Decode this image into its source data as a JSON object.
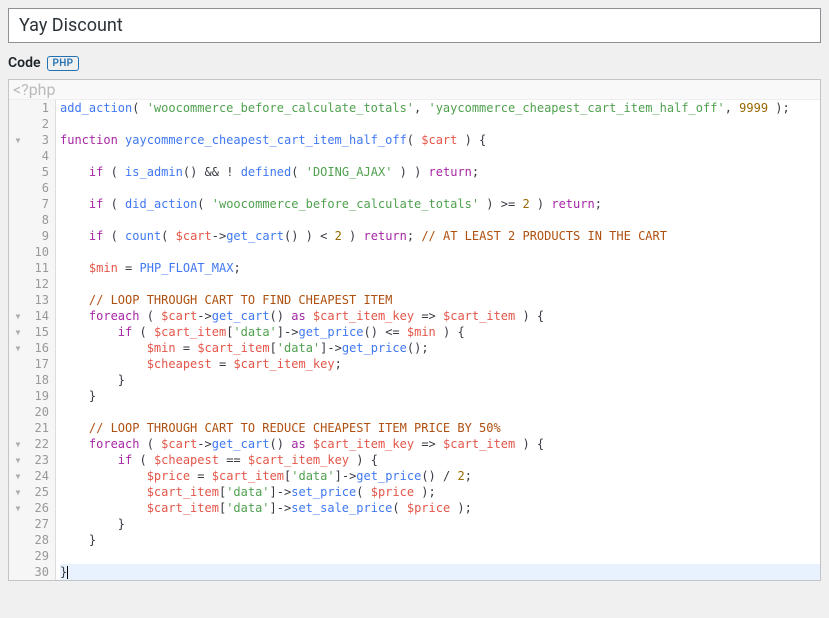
{
  "title_value": "Yay Discount",
  "section": {
    "label": "Code",
    "badge": "PHP"
  },
  "ghost_line": "<?php",
  "lines": [
    {
      "n": 1,
      "fold": "",
      "tokens": [
        [
          "fn",
          "add_action"
        ],
        [
          "pun",
          "( "
        ],
        [
          "str",
          "'woocommerce_before_calculate_totals'"
        ],
        [
          "pun",
          ", "
        ],
        [
          "str",
          "'yaycommerce_cheapest_cart_item_half_off'"
        ],
        [
          "pun",
          ", "
        ],
        [
          "num",
          "9999"
        ],
        [
          "pun",
          " );"
        ]
      ]
    },
    {
      "n": 2,
      "fold": "",
      "tokens": []
    },
    {
      "n": 3,
      "fold": "▾",
      "tokens": [
        [
          "kw",
          "function"
        ],
        [
          "op",
          " "
        ],
        [
          "fn",
          "yaycommerce_cheapest_cart_item_half_off"
        ],
        [
          "pun",
          "( "
        ],
        [
          "var",
          "$cart"
        ],
        [
          "pun",
          " ) {"
        ]
      ]
    },
    {
      "n": 4,
      "fold": "",
      "tokens": []
    },
    {
      "n": 5,
      "fold": "",
      "indent": 1,
      "tokens": [
        [
          "ctrl",
          "if"
        ],
        [
          "pun",
          " ( "
        ],
        [
          "fn",
          "is_admin"
        ],
        [
          "pun",
          "() "
        ],
        [
          "op",
          "&&"
        ],
        [
          "pun",
          " "
        ],
        [
          "op",
          "!"
        ],
        [
          "pun",
          " "
        ],
        [
          "fn",
          "defined"
        ],
        [
          "pun",
          "( "
        ],
        [
          "str",
          "'DOING_AJAX'"
        ],
        [
          "pun",
          " ) ) "
        ],
        [
          "ctrl",
          "return"
        ],
        [
          "pun",
          ";"
        ]
      ]
    },
    {
      "n": 6,
      "fold": "",
      "tokens": []
    },
    {
      "n": 7,
      "fold": "",
      "indent": 1,
      "tokens": [
        [
          "ctrl",
          "if"
        ],
        [
          "pun",
          " ( "
        ],
        [
          "fn",
          "did_action"
        ],
        [
          "pun",
          "( "
        ],
        [
          "str",
          "'woocommerce_before_calculate_totals'"
        ],
        [
          "pun",
          " ) "
        ],
        [
          "op",
          ">="
        ],
        [
          "pun",
          " "
        ],
        [
          "num",
          "2"
        ],
        [
          "pun",
          " ) "
        ],
        [
          "ctrl",
          "return"
        ],
        [
          "pun",
          ";"
        ]
      ]
    },
    {
      "n": 8,
      "fold": "",
      "tokens": []
    },
    {
      "n": 9,
      "fold": "",
      "indent": 1,
      "tokens": [
        [
          "ctrl",
          "if"
        ],
        [
          "pun",
          " ( "
        ],
        [
          "fn",
          "count"
        ],
        [
          "pun",
          "( "
        ],
        [
          "var",
          "$cart"
        ],
        [
          "op",
          "->"
        ],
        [
          "fn",
          "get_cart"
        ],
        [
          "pun",
          "() ) "
        ],
        [
          "op",
          "<"
        ],
        [
          "pun",
          " "
        ],
        [
          "num",
          "2"
        ],
        [
          "pun",
          " ) "
        ],
        [
          "ctrl",
          "return"
        ],
        [
          "pun",
          "; "
        ],
        [
          "comment",
          "// AT LEAST 2 PRODUCTS IN THE CART"
        ]
      ]
    },
    {
      "n": 10,
      "fold": "",
      "tokens": []
    },
    {
      "n": 11,
      "fold": "",
      "indent": 1,
      "tokens": [
        [
          "var",
          "$min"
        ],
        [
          "pun",
          " "
        ],
        [
          "op",
          "="
        ],
        [
          "pun",
          " "
        ],
        [
          "fn",
          "PHP_FLOAT_MAX"
        ],
        [
          "pun",
          ";"
        ]
      ]
    },
    {
      "n": 12,
      "fold": "",
      "tokens": []
    },
    {
      "n": 13,
      "fold": "",
      "indent": 1,
      "tokens": [
        [
          "comment",
          "// LOOP THROUGH CART TO FIND CHEAPEST ITEM"
        ]
      ]
    },
    {
      "n": 14,
      "fold": "▾",
      "indent": 1,
      "tokens": [
        [
          "ctrl",
          "foreach"
        ],
        [
          "pun",
          " ( "
        ],
        [
          "var",
          "$cart"
        ],
        [
          "op",
          "->"
        ],
        [
          "fn",
          "get_cart"
        ],
        [
          "pun",
          "() "
        ],
        [
          "kw",
          "as"
        ],
        [
          "pun",
          " "
        ],
        [
          "var",
          "$cart_item_key"
        ],
        [
          "pun",
          " "
        ],
        [
          "op",
          "=>"
        ],
        [
          "pun",
          " "
        ],
        [
          "var",
          "$cart_item"
        ],
        [
          "pun",
          " ) {"
        ]
      ]
    },
    {
      "n": 15,
      "fold": "▾",
      "indent": 2,
      "tokens": [
        [
          "ctrl",
          "if"
        ],
        [
          "pun",
          " ( "
        ],
        [
          "var",
          "$cart_item"
        ],
        [
          "pun",
          "["
        ],
        [
          "str",
          "'data'"
        ],
        [
          "pun",
          "]"
        ],
        [
          "op",
          "->"
        ],
        [
          "fn",
          "get_price"
        ],
        [
          "pun",
          "() "
        ],
        [
          "op",
          "<="
        ],
        [
          "pun",
          " "
        ],
        [
          "var",
          "$min"
        ],
        [
          "pun",
          " ) {"
        ]
      ]
    },
    {
      "n": 16,
      "fold": "▾",
      "indent": 3,
      "tokens": [
        [
          "var",
          "$min"
        ],
        [
          "pun",
          " "
        ],
        [
          "op",
          "="
        ],
        [
          "pun",
          " "
        ],
        [
          "var",
          "$cart_item"
        ],
        [
          "pun",
          "["
        ],
        [
          "str",
          "'data'"
        ],
        [
          "pun",
          "]"
        ],
        [
          "op",
          "->"
        ],
        [
          "fn",
          "get_price"
        ],
        [
          "pun",
          "();"
        ]
      ]
    },
    {
      "n": 17,
      "fold": "",
      "indent": 3,
      "tokens": [
        [
          "var",
          "$cheapest"
        ],
        [
          "pun",
          " "
        ],
        [
          "op",
          "="
        ],
        [
          "pun",
          " "
        ],
        [
          "var",
          "$cart_item_key"
        ],
        [
          "pun",
          ";"
        ]
      ]
    },
    {
      "n": 18,
      "fold": "",
      "indent": 2,
      "tokens": [
        [
          "pun",
          "}"
        ]
      ]
    },
    {
      "n": 19,
      "fold": "",
      "indent": 1,
      "tokens": [
        [
          "pun",
          "}"
        ]
      ]
    },
    {
      "n": 20,
      "fold": "",
      "tokens": []
    },
    {
      "n": 21,
      "fold": "",
      "indent": 1,
      "tokens": [
        [
          "comment",
          "// LOOP THROUGH CART TO REDUCE CHEAPEST ITEM PRICE BY 50%"
        ]
      ]
    },
    {
      "n": 22,
      "fold": "▾",
      "indent": 1,
      "tokens": [
        [
          "ctrl",
          "foreach"
        ],
        [
          "pun",
          " ( "
        ],
        [
          "var",
          "$cart"
        ],
        [
          "op",
          "->"
        ],
        [
          "fn",
          "get_cart"
        ],
        [
          "pun",
          "() "
        ],
        [
          "kw",
          "as"
        ],
        [
          "pun",
          " "
        ],
        [
          "var",
          "$cart_item_key"
        ],
        [
          "pun",
          " "
        ],
        [
          "op",
          "=>"
        ],
        [
          "pun",
          " "
        ],
        [
          "var",
          "$cart_item"
        ],
        [
          "pun",
          " ) {"
        ]
      ]
    },
    {
      "n": 23,
      "fold": "▾",
      "indent": 2,
      "tokens": [
        [
          "ctrl",
          "if"
        ],
        [
          "pun",
          " ( "
        ],
        [
          "var",
          "$cheapest"
        ],
        [
          "pun",
          " "
        ],
        [
          "op",
          "=="
        ],
        [
          "pun",
          " "
        ],
        [
          "var",
          "$cart_item_key"
        ],
        [
          "pun",
          " ) {"
        ]
      ]
    },
    {
      "n": 24,
      "fold": "▾",
      "indent": 3,
      "tokens": [
        [
          "var",
          "$price"
        ],
        [
          "pun",
          " "
        ],
        [
          "op",
          "="
        ],
        [
          "pun",
          " "
        ],
        [
          "var",
          "$cart_item"
        ],
        [
          "pun",
          "["
        ],
        [
          "str",
          "'data'"
        ],
        [
          "pun",
          "]"
        ],
        [
          "op",
          "->"
        ],
        [
          "fn",
          "get_price"
        ],
        [
          "pun",
          "() "
        ],
        [
          "op",
          "/"
        ],
        [
          "pun",
          " "
        ],
        [
          "num",
          "2"
        ],
        [
          "pun",
          ";"
        ]
      ]
    },
    {
      "n": 25,
      "fold": "▾",
      "indent": 3,
      "tokens": [
        [
          "var",
          "$cart_item"
        ],
        [
          "pun",
          "["
        ],
        [
          "str",
          "'data'"
        ],
        [
          "pun",
          "]"
        ],
        [
          "op",
          "->"
        ],
        [
          "fn",
          "set_price"
        ],
        [
          "pun",
          "( "
        ],
        [
          "var",
          "$price"
        ],
        [
          "pun",
          " );"
        ]
      ]
    },
    {
      "n": 26,
      "fold": "▾",
      "indent": 3,
      "tokens": [
        [
          "var",
          "$cart_item"
        ],
        [
          "pun",
          "["
        ],
        [
          "str",
          "'data'"
        ],
        [
          "pun",
          "]"
        ],
        [
          "op",
          "->"
        ],
        [
          "fn",
          "set_sale_price"
        ],
        [
          "pun",
          "( "
        ],
        [
          "var",
          "$price"
        ],
        [
          "pun",
          " );"
        ]
      ]
    },
    {
      "n": 27,
      "fold": "",
      "indent": 2,
      "tokens": [
        [
          "pun",
          "}"
        ]
      ]
    },
    {
      "n": 28,
      "fold": "",
      "indent": 1,
      "tokens": [
        [
          "pun",
          "}"
        ]
      ]
    },
    {
      "n": 29,
      "fold": "",
      "tokens": []
    },
    {
      "n": 30,
      "fold": "",
      "active": true,
      "tokens": [
        [
          "pun",
          "}"
        ],
        [
          "cursor",
          ""
        ]
      ]
    }
  ]
}
